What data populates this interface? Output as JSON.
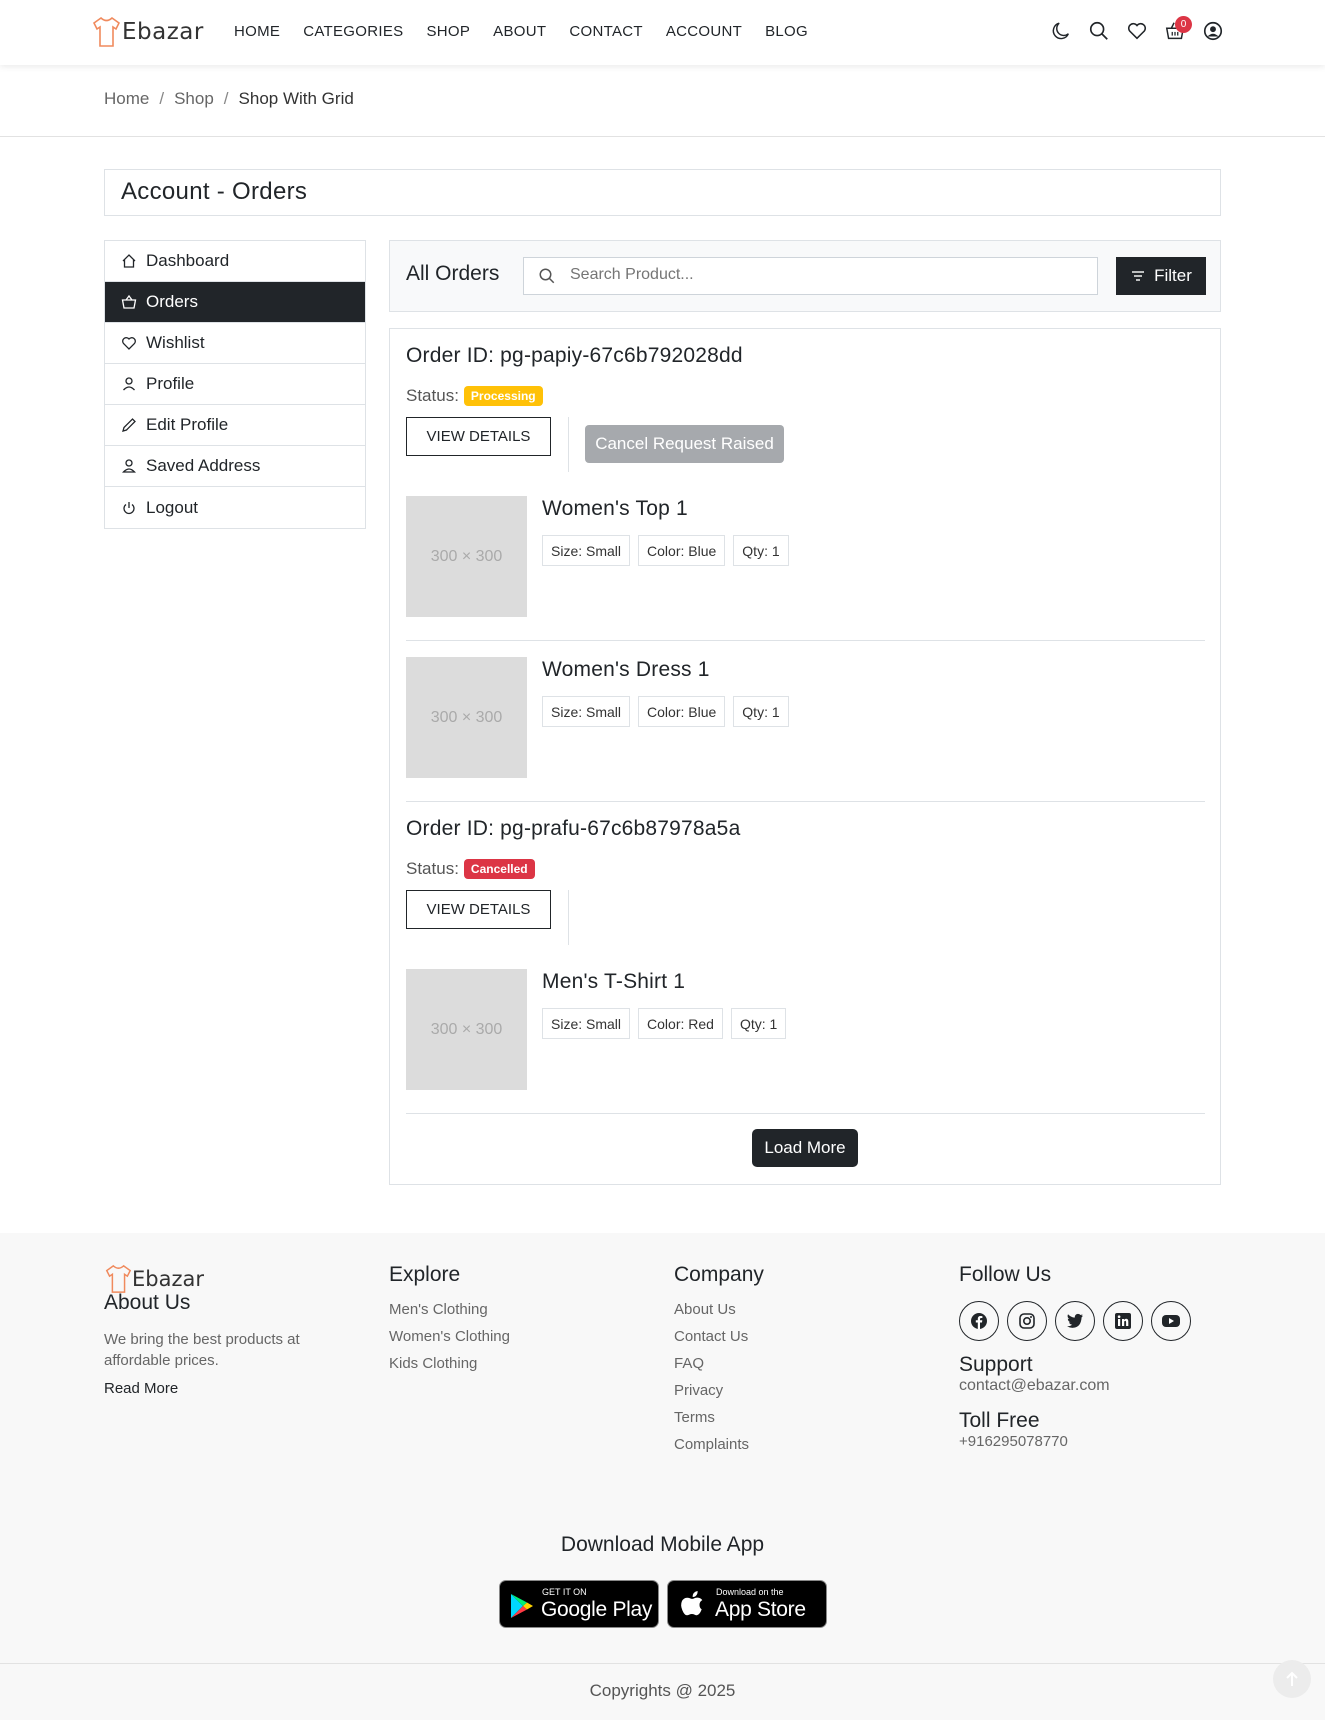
{
  "header": {
    "brand": "Ebazar",
    "nav": [
      "HOME",
      "CATEGORIES",
      "SHOP",
      "ABOUT",
      "CONTACT",
      "ACCOUNT",
      "BLOG"
    ],
    "cart_count": "0",
    "icons": [
      "moon-icon",
      "search-icon",
      "heart-icon",
      "cart-icon",
      "user-icon"
    ],
    "badge_color": "#dc3545"
  },
  "breadcrumb": {
    "home": "Home",
    "shop": "Shop",
    "current": "Shop With Grid"
  },
  "page": {
    "title": "Account - Orders"
  },
  "sidebar": {
    "items": [
      {
        "label": "Dashboard",
        "icon": "home-icon"
      },
      {
        "label": "Orders",
        "icon": "basket-icon"
      },
      {
        "label": "Wishlist",
        "icon": "heart-icon"
      },
      {
        "label": "Profile",
        "icon": "user-icon"
      },
      {
        "label": "Edit Profile",
        "icon": "pencil-icon"
      },
      {
        "label": "Saved Address",
        "icon": "user-icon"
      },
      {
        "label": "Logout",
        "icon": "power-icon"
      }
    ],
    "active_index": 1
  },
  "toolbar": {
    "title": "All Orders",
    "search_placeholder": "Search Product...",
    "filter_label": "Filter"
  },
  "orders": [
    {
      "id_label": "Order ID: pg-papiy-67c6b792028dd",
      "status_label": "Status:",
      "status": "Processing",
      "status_color": "#ffc107",
      "view_label": "VIEW DETAILS",
      "cancel_label": "Cancel Request Raised",
      "items": [
        {
          "name": "Women's Top 1",
          "image_text": "300 × 300",
          "size": "Size: Small",
          "color": "Color: Blue",
          "qty": "Qty: 1"
        },
        {
          "name": "Women's Dress 1",
          "image_text": "300 × 300",
          "size": "Size: Small",
          "color": "Color: Blue",
          "qty": "Qty: 1"
        }
      ]
    },
    {
      "id_label": "Order ID: pg-prafu-67c6b87978a5a",
      "status_label": "Status:",
      "status": "Cancelled",
      "status_color": "#dc3545",
      "view_label": "VIEW DETAILS",
      "items": [
        {
          "name": "Men's T-Shirt 1",
          "image_text": "300 × 300",
          "size": "Size: Small",
          "color": "Color: Red",
          "qty": "Qty: 1"
        }
      ]
    }
  ],
  "load_more": "Load More",
  "footer": {
    "brand": "Ebazar",
    "about_title": "About Us",
    "about_text": "We bring the best products at affordable prices.",
    "read_more": "Read More",
    "explore_title": "Explore",
    "explore_links": [
      "Men's Clothing",
      "Women's Clothing",
      "Kids Clothing"
    ],
    "company_title": "Company",
    "company_links": [
      "About Us",
      "Contact Us",
      "FAQ",
      "Privacy",
      "Terms",
      "Complaints"
    ],
    "follow_title": "Follow Us",
    "social_icons": [
      "facebook-icon",
      "instagram-icon",
      "twitter-icon",
      "linkedin-icon",
      "youtube-icon"
    ],
    "support_title": "Support",
    "support_email": "contact@ebazar.com",
    "tollfree_title": "Toll Free",
    "tollfree_number": "+916295078770",
    "download_title": "Download Mobile App",
    "google_small": "GET IT ON",
    "google_big": "Google Play",
    "apple_small": "Download on the",
    "apple_big": "App Store",
    "copyright": "Copyrights @ 2025"
  }
}
